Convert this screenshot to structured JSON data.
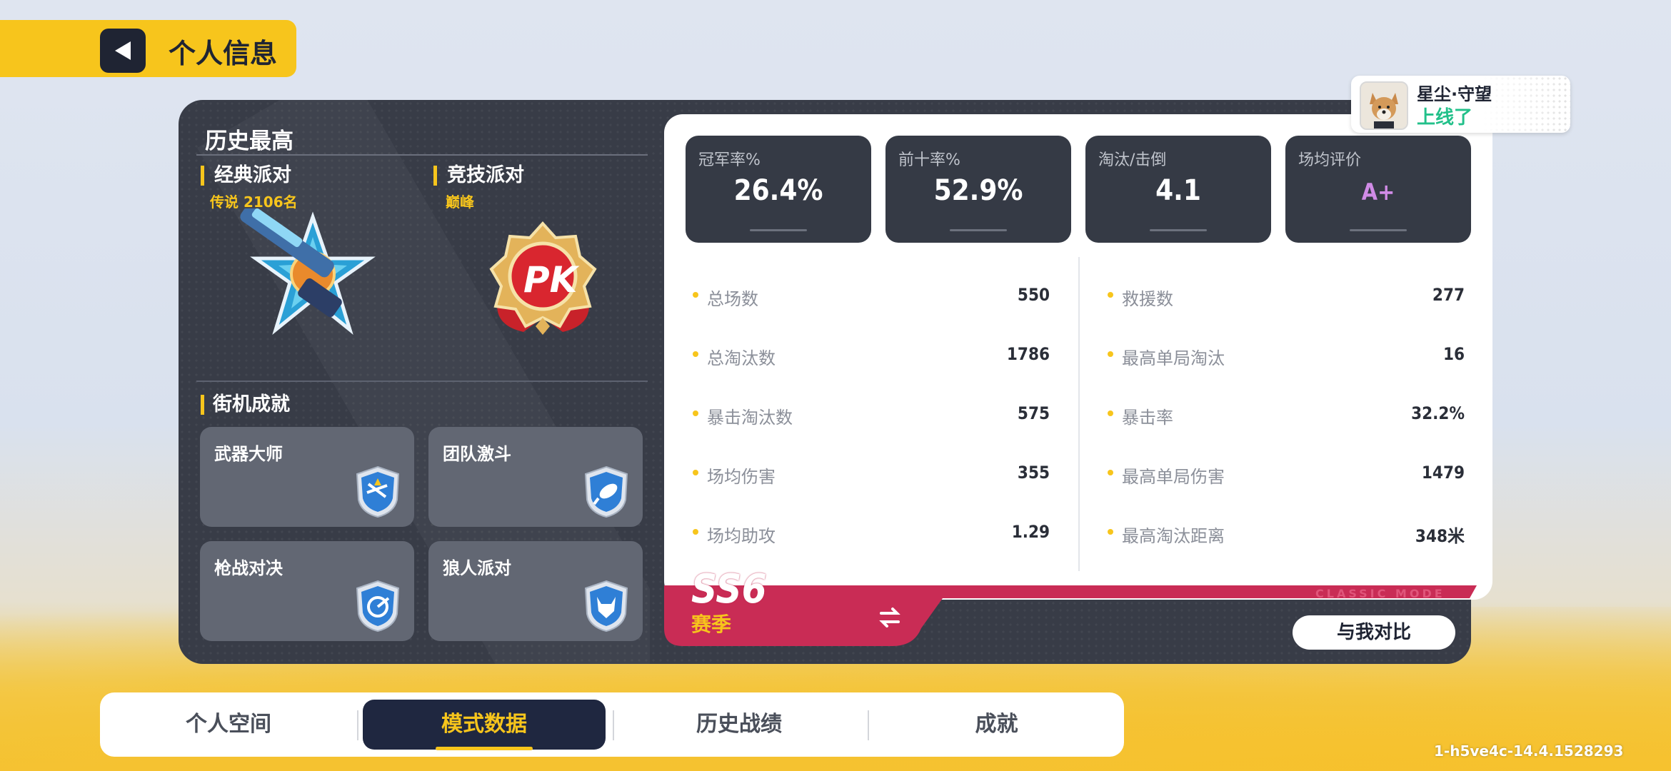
{
  "header": {
    "title": "个人信息"
  },
  "history": {
    "title": "历史最高",
    "modes": [
      {
        "label": "经典派对",
        "rank": "传说 2106名"
      },
      {
        "label": "竞技派对",
        "rank": "巅峰"
      }
    ]
  },
  "arcade": {
    "title": "街机成就",
    "items": [
      {
        "label": "武器大师"
      },
      {
        "label": "团队激斗"
      },
      {
        "label": "枪战对决"
      },
      {
        "label": "狼人派对"
      }
    ]
  },
  "stat_cards": [
    {
      "title": "冠军率%",
      "value": "26.4%"
    },
    {
      "title": "前十率%",
      "value": "52.9%"
    },
    {
      "title": "淘汰/击倒",
      "value": "4.1"
    },
    {
      "title": "场均评价",
      "value": "A+"
    }
  ],
  "stats_left": [
    {
      "label": "总场数",
      "value": "550"
    },
    {
      "label": "总淘汰数",
      "value": "1786"
    },
    {
      "label": "暴击淘汰数",
      "value": "575"
    },
    {
      "label": "场均伤害",
      "value": "355"
    },
    {
      "label": "场均助攻",
      "value": "1.29"
    }
  ],
  "stats_right": [
    {
      "label": "救援数",
      "value": "277"
    },
    {
      "label": "最高单局淘汰",
      "value": "16"
    },
    {
      "label": "暴击率",
      "value": "32.2%"
    },
    {
      "label": "最高单局伤害",
      "value": "1479"
    },
    {
      "label": "最高淘汰距离",
      "value": "348米"
    }
  ],
  "season": {
    "code": "SS6",
    "label": "赛季",
    "mode_text": "CLASSIC MODE",
    "compare_label": "与我对比"
  },
  "notification": {
    "name": "星尘·守望",
    "status": "上线了"
  },
  "tabs": [
    {
      "label": "个人空间"
    },
    {
      "label": "模式数据"
    },
    {
      "label": "历史战绩"
    },
    {
      "label": "成就"
    }
  ],
  "version": "1-h5ve4c-14.4.1528293",
  "colors": {
    "accent": "#f7c51c",
    "panel": "#383c47",
    "season_red": "#c92c55",
    "online": "#22c08a",
    "grade": "#d08be6"
  }
}
